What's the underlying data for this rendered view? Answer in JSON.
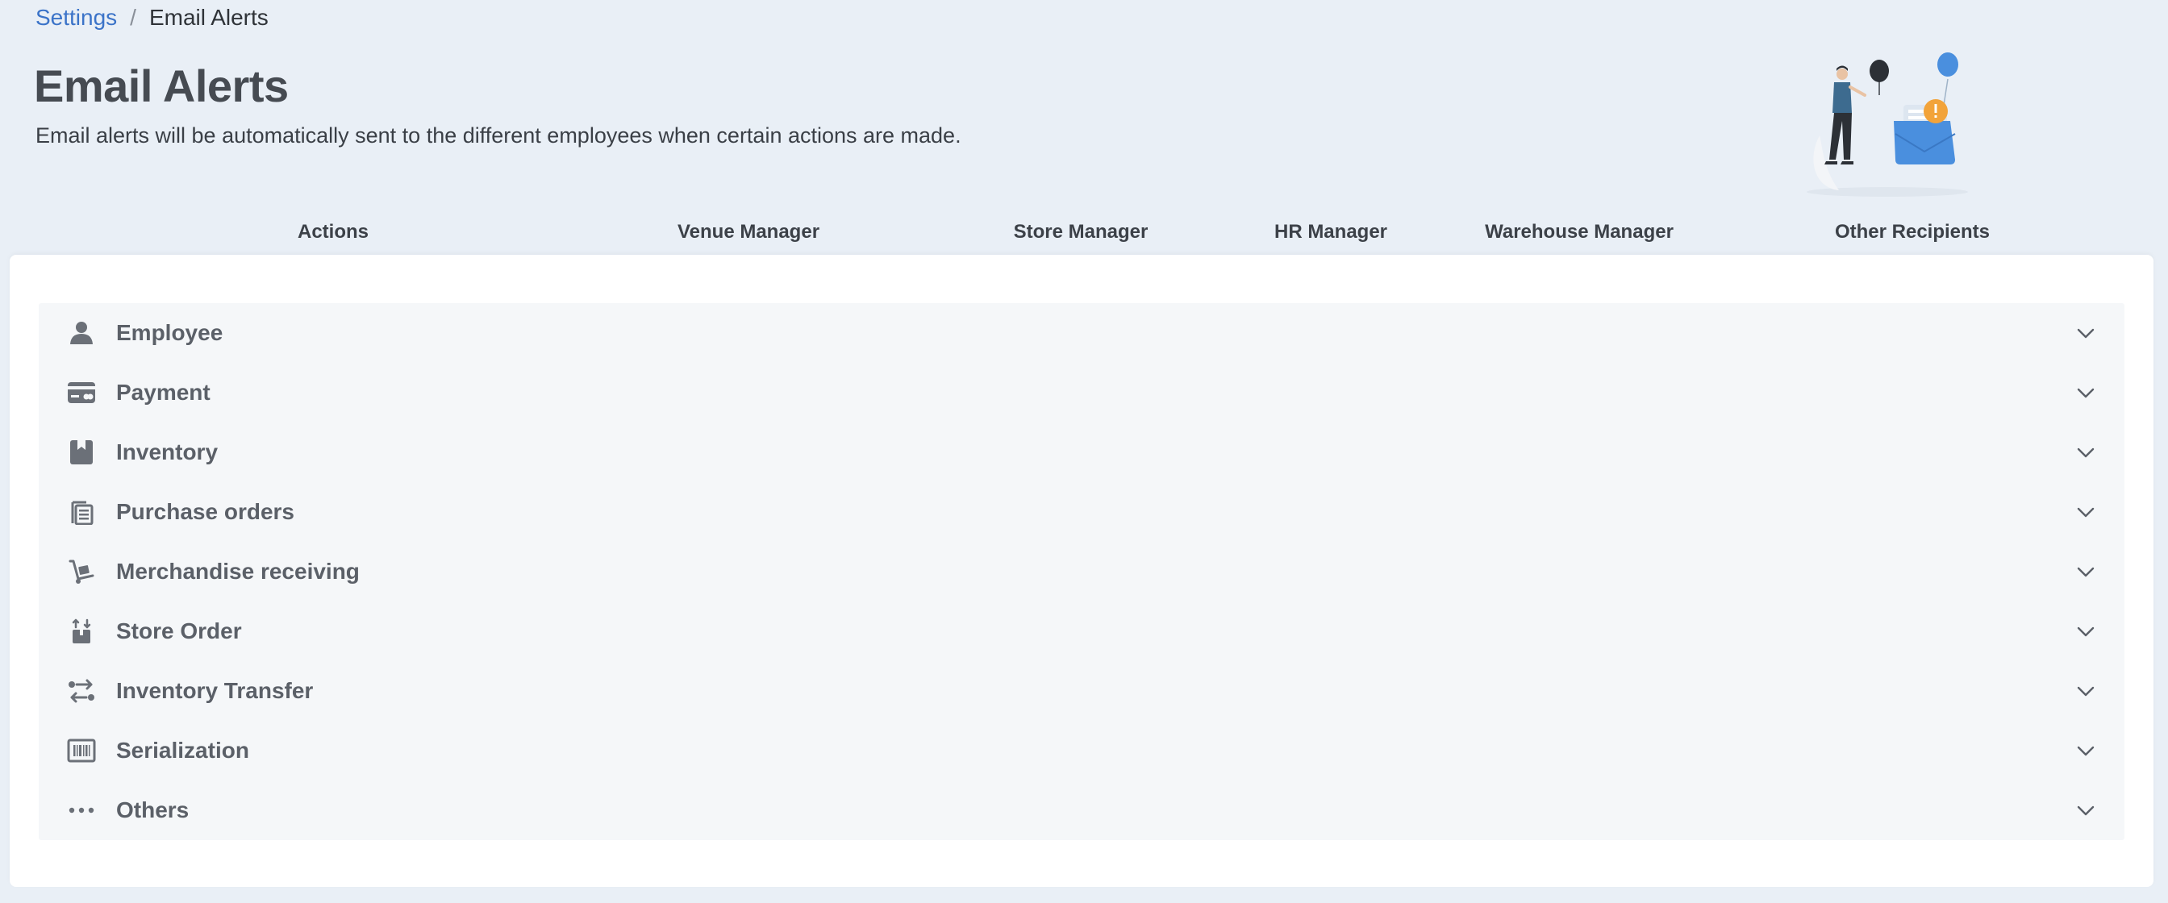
{
  "breadcrumb": {
    "parent": "Settings",
    "separator": "/",
    "current": "Email Alerts"
  },
  "page": {
    "title": "Email Alerts",
    "subtitle": "Email alerts will be automatically sent to the different employees when certain actions are made."
  },
  "columns": [
    "Actions",
    "Venue Manager",
    "Store Manager",
    "HR Manager",
    "Warehouse Manager",
    "Other Recipients"
  ],
  "categories": [
    {
      "label": "Employee",
      "icon": "person-icon"
    },
    {
      "label": "Payment",
      "icon": "credit-card-icon"
    },
    {
      "label": "Inventory",
      "icon": "box-icon"
    },
    {
      "label": "Purchase orders",
      "icon": "documents-icon"
    },
    {
      "label": "Merchandise receiving",
      "icon": "hand-truck-icon"
    },
    {
      "label": "Store Order",
      "icon": "package-arrow-icon"
    },
    {
      "label": "Inventory Transfer",
      "icon": "transfer-arrows-icon"
    },
    {
      "label": "Serialization",
      "icon": "barcode-icon"
    },
    {
      "label": "Others",
      "icon": "more-dots-icon"
    }
  ],
  "colors": {
    "background": "#e9eff6",
    "link": "#3b73c8",
    "icon": "#6b7078",
    "accent_blue": "#4a8fde",
    "accent_orange": "#f2a33a"
  }
}
